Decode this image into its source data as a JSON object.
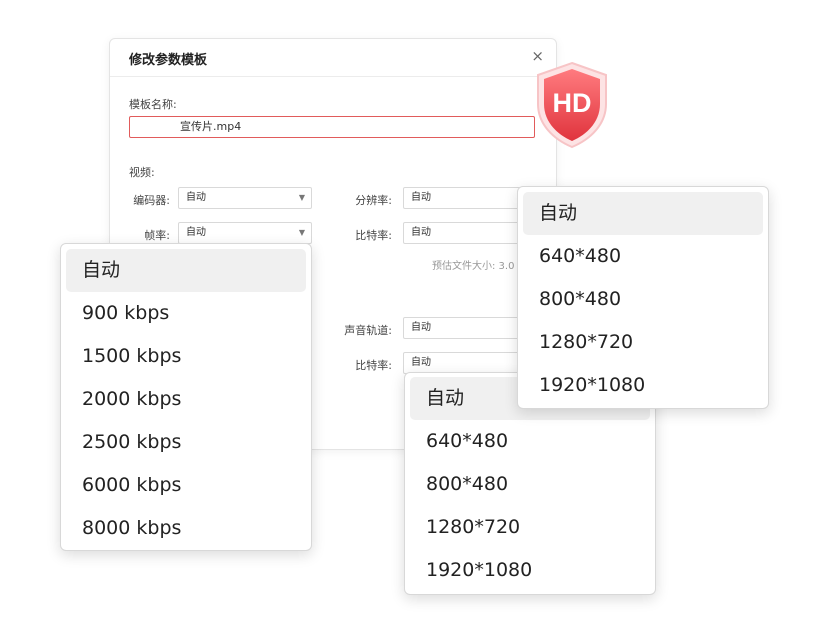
{
  "dialog": {
    "title": "修改参数模板",
    "close_glyph": "×",
    "name_label": "模板名称:",
    "name_value": "宣传片.mp4",
    "video_section": "视频:",
    "encoder_label": "编码器:",
    "encoder_value": "自动",
    "resolution_label": "分辨率:",
    "resolution_value": "自动",
    "framerate_label": "帧率:",
    "framerate_value": "自动",
    "bitrate_label": "比特率:",
    "bitrate_value": "自动",
    "estimate_text": "预估文件大小: 3.0",
    "audio_track_label": "声音轨道:",
    "audio_track_value": "自动",
    "audio_bitrate_label": "比特率:",
    "audio_bitrate_value": "自动"
  },
  "bitrate_dropdown": {
    "options": [
      "自动",
      "900 kbps",
      "1500 kbps",
      "2000 kbps",
      "2500 kbps",
      "6000 kbps",
      "8000 kbps"
    ],
    "selected": "自动"
  },
  "resolution_dropdown_top": {
    "options": [
      "自动",
      "640*480",
      "800*480",
      "1280*720",
      "1920*1080"
    ],
    "selected": "自动"
  },
  "resolution_dropdown_bottom": {
    "options": [
      "自动",
      "640*480",
      "800*480",
      "1280*720",
      "1920*1080"
    ],
    "selected": "自动"
  },
  "hd_badge": {
    "text": "HD",
    "icon": "hd-shield-icon",
    "color": "#e8484f"
  },
  "colors": {
    "input_error_border": "#e15b5b",
    "dropdown_selected_bg": "#f0f0f0"
  }
}
